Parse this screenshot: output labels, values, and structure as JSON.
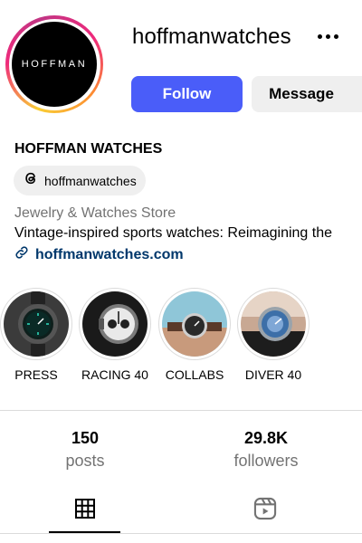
{
  "profile": {
    "username": "hoffmanwatches",
    "avatar_text": "HOFFMAN",
    "display_name": "HOFFMAN WATCHES",
    "threads_handle": "hoffmanwatches",
    "category": "Jewelry & Watches Store",
    "bio": "Vintage-inspired sports watches: Reimagining the",
    "link": "hoffmanwatches.com"
  },
  "actions": {
    "follow_label": "Follow",
    "message_label": "Message",
    "more_icon": "more-horizontal-icon"
  },
  "highlights": [
    {
      "label": "PRESS"
    },
    {
      "label": "RACING 40"
    },
    {
      "label": "COLLABS"
    },
    {
      "label": "DIVER 40"
    }
  ],
  "stats": [
    {
      "value": "150",
      "label": "posts"
    },
    {
      "value": "29.8K",
      "label": "followers"
    }
  ],
  "tabs": [
    {
      "icon": "grid-icon",
      "active": true
    },
    {
      "icon": "reels-icon",
      "active": false
    }
  ],
  "colors": {
    "follow_button": "#4a5df9",
    "message_button": "#efefef",
    "link": "#00376b",
    "secondary_text": "#737373"
  }
}
